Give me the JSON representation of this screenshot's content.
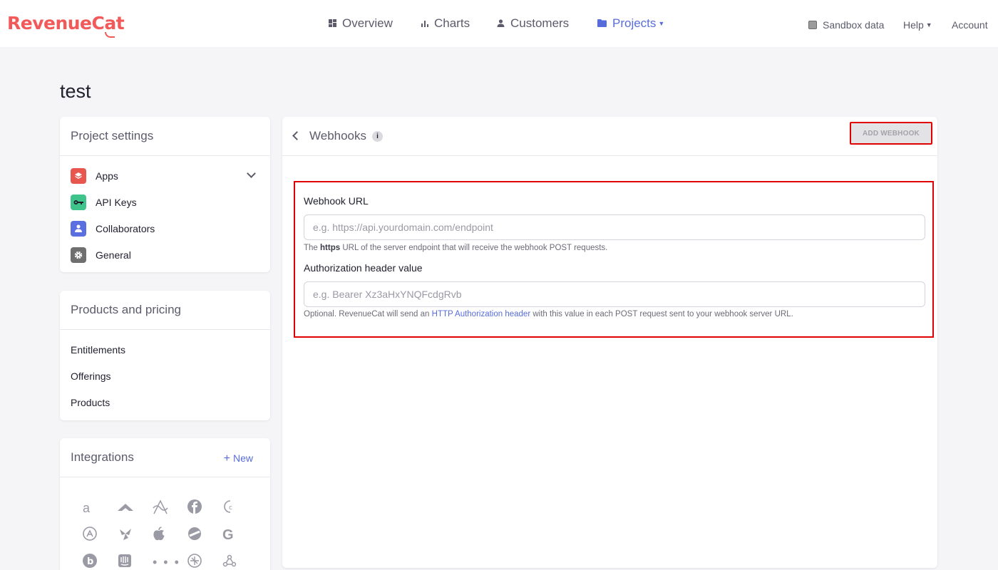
{
  "brand": {
    "name": "RevenueCat",
    "color": "#f25a5a"
  },
  "nav": {
    "overview": "Overview",
    "charts": "Charts",
    "customers": "Customers",
    "projects": "Projects"
  },
  "top_right": {
    "sandbox": "Sandbox data",
    "help": "Help",
    "account": "Account"
  },
  "page": {
    "title": "test"
  },
  "project_settings": {
    "title": "Project settings",
    "items": [
      {
        "label": "Apps",
        "icon": "layers-icon",
        "color": "#e8574f"
      },
      {
        "label": "API Keys",
        "icon": "key-icon",
        "color": "#3ec48a"
      },
      {
        "label": "Collaborators",
        "icon": "person-icon",
        "color": "#5c6fe0"
      },
      {
        "label": "General",
        "icon": "gear-icon",
        "color": "#6f6f6f"
      }
    ]
  },
  "products_pricing": {
    "title": "Products and pricing",
    "items": [
      "Entitlements",
      "Offerings",
      "Products"
    ]
  },
  "integrations": {
    "title": "Integrations",
    "new_label": "New",
    "logos": [
      "amazon-icon",
      "airship-icon",
      "appsflyer-icon",
      "facebook-icon",
      "clevertap-icon",
      "appstore-icon",
      "mparticle-icon",
      "apple-icon",
      "segment-icon",
      "google-icon",
      "branch-icon",
      "intercom-icon",
      "dots-icon",
      "adjust-icon",
      "webhook-icon"
    ]
  },
  "webhooks": {
    "title": "Webhooks",
    "add_button": "ADD WEBHOOK",
    "url_label": "Webhook URL",
    "url_placeholder": "e.g. https://api.yourdomain.com/endpoint",
    "url_hint_pre": "The",
    "url_hint_bold": "https",
    "url_hint_post": "URL of the server endpoint that will receive the webhook POST requests.",
    "auth_label": "Authorization header value",
    "auth_placeholder": "e.g. Bearer Xz3aHxYNQFcdgRvb",
    "auth_hint_pre": "Optional. RevenueCat will send an",
    "auth_hint_link": "HTTP Authorization header",
    "auth_hint_post": "with this value in each POST request sent to your webhook server URL."
  },
  "accent_color": "#576cdb"
}
